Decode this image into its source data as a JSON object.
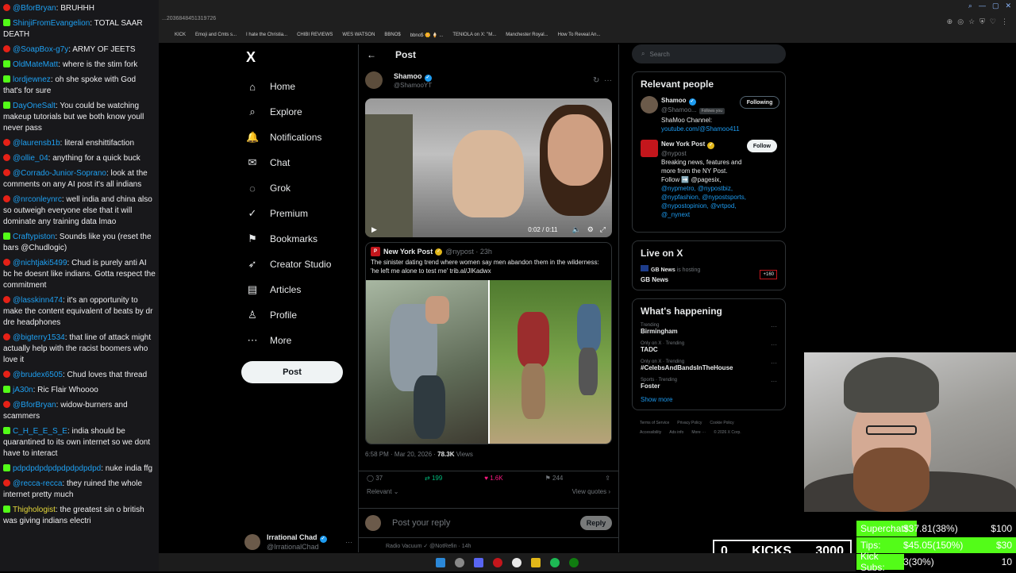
{
  "chat": [
    {
      "platform": "yt",
      "user": "@BforBryan",
      "text": "BRUHHH",
      "color": "blue"
    },
    {
      "platform": "kick",
      "user": "ShinjiFromEvangelion",
      "text": "TOTAL SAAR DEATH",
      "color": "blue"
    },
    {
      "platform": "yt",
      "user": "@SoapBox-g7y",
      "text": "ARMY OF JEETS",
      "color": "blue"
    },
    {
      "platform": "kick",
      "user": "OldMateMatt",
      "text": "where is the stim fork",
      "color": "blue"
    },
    {
      "platform": "kick",
      "user": "lordjewnez",
      "text": "oh she spoke with God that's for sure",
      "color": "blue"
    },
    {
      "platform": "kick",
      "user": "DayOneSalt",
      "text": "You could be watching makeup tutorials but we both know youll never pass",
      "color": "blue"
    },
    {
      "platform": "yt",
      "user": "@laurensb1b",
      "text": "literal enshittifaction",
      "color": "blue"
    },
    {
      "platform": "yt",
      "user": "@ollie_04",
      "text": "anything for a quick buck",
      "color": "blue"
    },
    {
      "platform": "yt",
      "user": "@Corrado-Junior-Soprano",
      "text": "look at the comments on any AI post it's all indians",
      "color": "blue"
    },
    {
      "platform": "yt",
      "user": "@nrconleynrc",
      "text": "well india and china also so outweigh everyone else that it will dominate any training data lmao",
      "color": "blue"
    },
    {
      "platform": "kick",
      "user": "Craftypiston",
      "text": "Sounds like you (reset the bars @Chudlogic)",
      "color": "blue"
    },
    {
      "platform": "yt",
      "user": "@nichtjaki5499",
      "text": "Chud is purely anti AI bc he doesnt like indians. Gotta respect the commitment",
      "color": "blue"
    },
    {
      "platform": "yt",
      "user": "@lasskinn474",
      "text": "it's an opportunity to make the content equivalent of beats by dr dre headphones",
      "color": "blue"
    },
    {
      "platform": "yt",
      "user": "@bigterry1534",
      "text": "that line of attack might actually help with the racist boomers who love it",
      "color": "blue"
    },
    {
      "platform": "yt",
      "user": "@brudex6505",
      "text": "Chud loves that thread",
      "color": "blue"
    },
    {
      "platform": "kick",
      "user": "jA30n",
      "text": "Ric Flair Whoooo",
      "color": "blue"
    },
    {
      "platform": "yt",
      "user": "@BforBryan",
      "text": "widow-burners and scammers",
      "color": "blue"
    },
    {
      "platform": "kick",
      "user": "C_H_E_E_S_E",
      "text": "india should be quarantined to its own internet so we dont have to interact",
      "color": "blue"
    },
    {
      "platform": "kick",
      "user": "pdpdpdpdpdpdpdpdpdpd",
      "text": "nuke india ffg",
      "color": "blue"
    },
    {
      "platform": "yt",
      "user": "@recca-recca",
      "text": "they ruined the whole internet pretty much",
      "color": "blue"
    },
    {
      "platform": "kick",
      "user": "Thighologist",
      "text": "the greatest sin o british was giving indians electri",
      "color": "yellow"
    }
  ],
  "browser": {
    "address": "...2036848451319726",
    "bookmarks": [
      "KICK",
      "Emoji and Cmts s...",
      "I hate the Christia...",
      "CHIBI REVIEWS",
      "WES WATSON",
      "BBNO$",
      "bbno$ 🌼 🍦 ...",
      "TENIOLA on X: \"M...",
      "Manchester Royal...",
      "How To Reveal An..."
    ]
  },
  "nav": {
    "logo": "X",
    "items": [
      {
        "label": "Home",
        "icon": "home-icon",
        "glyph": "⌂"
      },
      {
        "label": "Explore",
        "icon": "search-icon",
        "glyph": "⌕"
      },
      {
        "label": "Notifications",
        "icon": "bell-icon",
        "glyph": "🔔"
      },
      {
        "label": "Chat",
        "icon": "chat-icon",
        "glyph": "✉"
      },
      {
        "label": "Grok",
        "icon": "grok-icon",
        "glyph": "◌"
      },
      {
        "label": "Premium",
        "icon": "premium-icon",
        "glyph": "✓"
      },
      {
        "label": "Bookmarks",
        "icon": "bookmark-icon",
        "glyph": "⚑"
      },
      {
        "label": "Creator Studio",
        "icon": "rocket-icon",
        "glyph": "➶"
      },
      {
        "label": "Articles",
        "icon": "article-icon",
        "glyph": "▤"
      },
      {
        "label": "Profile",
        "icon": "profile-icon",
        "glyph": "♙"
      },
      {
        "label": "More",
        "icon": "more-icon",
        "glyph": "⋯"
      }
    ],
    "post_label": "Post",
    "account": {
      "name": "Irrational Chad",
      "handle": "@IrrationalChad"
    }
  },
  "main": {
    "header": "Post",
    "author": {
      "name": "Shamoo",
      "handle": "@ShamooYT"
    },
    "video": {
      "time": "0:02 / 0:11"
    },
    "quote": {
      "name": "New York Post",
      "meta": "@nypost · 23h",
      "text": "The sinister dating trend where women say men abandon them in the wilderness: 'he left me alone to test me' trib.al/JIKadwx"
    },
    "meta_line": {
      "time": "6:58 PM · Mar 20, 2026 · ",
      "views": "78.3K",
      "views_label": " Views"
    },
    "engagement": {
      "replies": "37",
      "reposts": "199",
      "likes": "1.6K",
      "bookmarks": "244"
    },
    "sort": {
      "left": "Relevant ⌄",
      "right": "View quotes ›"
    },
    "reply": {
      "placeholder": "Post your reply",
      "button": "Reply"
    },
    "next_post": "Radio Vacuum ✓ @NotRefin · 14h"
  },
  "right": {
    "search_placeholder": "Search",
    "relevant": {
      "title": "Relevant people",
      "people": [
        {
          "name": "Shamoo",
          "handle": "@Shamoo...",
          "tag": "Follows you",
          "bio": "ShaMoo Channel:",
          "link": "youtube.com/@Shamoo411",
          "button": "Following",
          "btn_class": "following"
        },
        {
          "name": "New York Post",
          "handle": "@nypost",
          "tag": "",
          "bio": "Breaking news, features and more from the NY Post. Follow ➡️ @pagesix,",
          "link": "@nypmetro, @nypostbiz, @nypfashion, @nypostsports, @nypostopinion, @vrtpod, @_nynext",
          "button": "Follow",
          "btn_class": "follow"
        }
      ]
    },
    "live": {
      "title": "Live on X",
      "host": "GB News",
      "host_suffix": " is hosting",
      "stream_title": "GB News",
      "count": "+160"
    },
    "happening": {
      "title": "What's happening",
      "trends": [
        {
          "context": "Trending",
          "name": "Birmingham"
        },
        {
          "context": "Only on X · Trending",
          "name": "TADC"
        },
        {
          "context": "Only on X · Trending",
          "name": "#CelebsAndBandsInTheHouse"
        },
        {
          "context": "Sports · Trending",
          "name": "Foster"
        }
      ],
      "show_more": "Show more"
    },
    "footer": [
      "Terms of Service",
      "Privacy Policy",
      "Cookie Policy",
      "Accessibility",
      "Ads info",
      "More ···",
      "© 2026 X Corp."
    ]
  },
  "overlay": {
    "kicks_left": "0",
    "kicks_label": "KICKS",
    "kicks_target": "3000",
    "goals": [
      {
        "label": "Superchats:",
        "value": "$37.81(38%)",
        "target": "$100",
        "percent": 38
      },
      {
        "label": "Tips:",
        "value": "$45.05(150%)",
        "target": "$30",
        "percent": 100
      },
      {
        "label": "Kick Subs:",
        "value": "3(30%)",
        "target": "10",
        "percent": 30
      }
    ]
  },
  "colors": {
    "accent": "#1d9bf0",
    "kick_green": "#53fc18",
    "background": "#000000"
  }
}
